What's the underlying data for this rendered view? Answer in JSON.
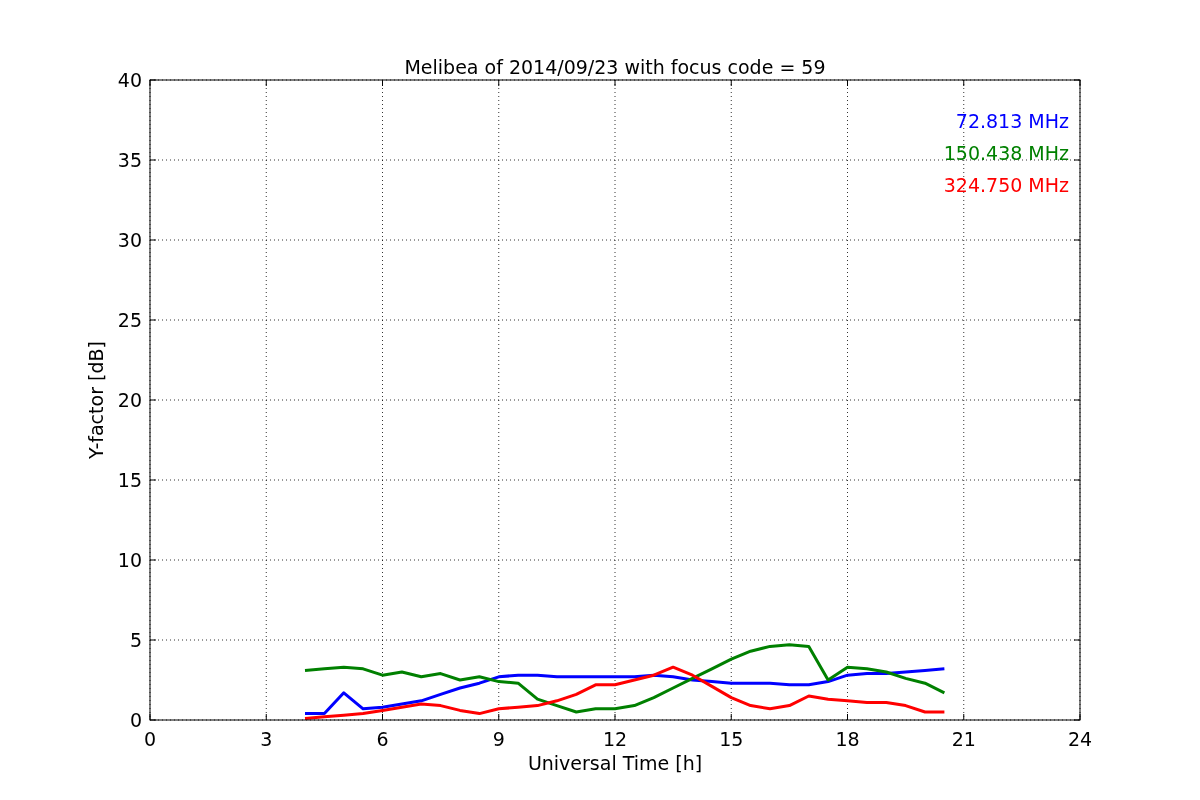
{
  "chart_data": {
    "type": "line",
    "title": "Melibea of 2014/09/23 with focus code = 59",
    "xlabel": "Universal Time [h]",
    "ylabel": "Y-factor [dB]",
    "x": [
      4,
      4.5,
      5,
      5.5,
      6,
      6.5,
      7,
      7.5,
      8,
      8.5,
      9,
      9.5,
      10,
      10.5,
      11,
      11.5,
      12,
      12.5,
      13,
      13.5,
      14,
      14.5,
      15,
      15.5,
      16,
      16.5,
      17,
      17.5,
      18,
      18.5,
      19,
      19.5,
      20,
      20.5
    ],
    "series": [
      {
        "name": "72.813 MHz",
        "color": "#0000ff",
        "values": [
          0.4,
          0.4,
          1.7,
          0.7,
          0.8,
          1.0,
          1.2,
          1.6,
          2.0,
          2.3,
          2.7,
          2.8,
          2.8,
          2.7,
          2.7,
          2.7,
          2.7,
          2.7,
          2.8,
          2.7,
          2.5,
          2.4,
          2.3,
          2.3,
          2.3,
          2.2,
          2.2,
          2.4,
          2.8,
          2.9,
          2.9,
          3.0,
          3.1,
          3.2
        ]
      },
      {
        "name": "150.438 MHz",
        "color": "#008000",
        "values": [
          3.1,
          3.2,
          3.3,
          3.2,
          2.8,
          3.0,
          2.7,
          2.9,
          2.5,
          2.7,
          2.4,
          2.3,
          1.3,
          0.9,
          0.5,
          0.7,
          0.7,
          0.9,
          1.4,
          2.0,
          2.6,
          3.2,
          3.8,
          4.3,
          4.6,
          4.7,
          4.6,
          2.5,
          3.3,
          3.2,
          3.0,
          2.6,
          2.3,
          1.7
        ]
      },
      {
        "name": "324.750 MHz",
        "color": "#ff0000",
        "values": [
          0.1,
          0.2,
          0.3,
          0.4,
          0.6,
          0.8,
          1.0,
          0.9,
          0.6,
          0.4,
          0.7,
          0.8,
          0.9,
          1.2,
          1.6,
          2.2,
          2.2,
          2.5,
          2.8,
          3.3,
          2.8,
          2.1,
          1.4,
          0.9,
          0.7,
          0.9,
          1.5,
          1.3,
          1.2,
          1.1,
          1.1,
          0.9,
          0.5,
          0.5
        ]
      }
    ],
    "xlim": [
      0,
      24
    ],
    "ylim": [
      0,
      40
    ],
    "xticks": [
      0,
      3,
      6,
      9,
      12,
      15,
      18,
      21,
      24
    ],
    "yticks": [
      0,
      5,
      10,
      15,
      20,
      25,
      30,
      35,
      40
    ],
    "grid": true
  }
}
